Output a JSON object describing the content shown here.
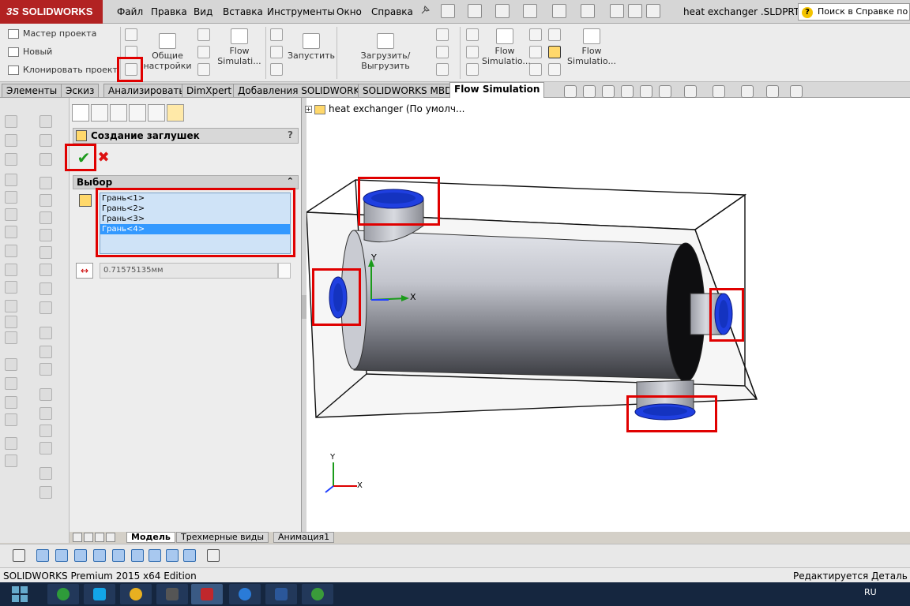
{
  "app": {
    "logo_prefix": "3S",
    "logo_text": "SOLIDWORKS",
    "document_title": "heat exchanger .SLDPRT *",
    "help_search": "Поиск в Справке по S"
  },
  "menu": [
    "Файл",
    "Правка",
    "Вид",
    "Вставка",
    "Инструменты",
    "Окно",
    "Справка"
  ],
  "ribbon": {
    "project_wizard": "Мастер проекта",
    "new": "Новый",
    "clone_project": "Клонировать проект",
    "general_settings_1": "Общие",
    "general_settings_2": "настройки",
    "flow_sim_1_a": "Flow",
    "flow_sim_1_b": "Simulati...",
    "run": "Запустить",
    "load_unload": "Загрузить/Выгрузить",
    "flow_sim_2_a": "Flow",
    "flow_sim_2_b": "Simulatio...",
    "flow_sim_3_a": "Flow",
    "flow_sim_3_b": "Simulatio..."
  },
  "tabs": [
    "Элементы",
    "Эскиз",
    "Анализировать",
    "DimXpert",
    "Добавления SOLIDWORKS",
    "SOLIDWORKS MBD",
    "Flow Simulation"
  ],
  "property_manager": {
    "title": "Создание заглушек",
    "help": "?",
    "ok_symbol": "✔",
    "cancel_symbol": "✖",
    "selection_header": "Выбор",
    "collapse_symbol": "⌃",
    "faces": [
      "Грань<1>",
      "Грань<2>",
      "Грань<3>",
      "Грань<4>"
    ],
    "selected_face_index": 3,
    "thickness_value": "0.71575135мм"
  },
  "tree": {
    "expand": "+",
    "label": "heat exchanger  (По умолч..."
  },
  "axes": {
    "x": "X",
    "y": "Y"
  },
  "bottom_tabs": [
    "Модель",
    "Трехмерные виды",
    "Анимация1"
  ],
  "status": {
    "left": "SOLIDWORKS Premium 2015 x64 Edition",
    "right": "Редактируется Деталь"
  },
  "taskbar": {
    "language": "RU"
  },
  "colors": {
    "accent_red": "#e00000",
    "selection_blue": "#3399ff",
    "list_bg": "#cfe3f7",
    "lid_blue": "#1f3fe0"
  }
}
